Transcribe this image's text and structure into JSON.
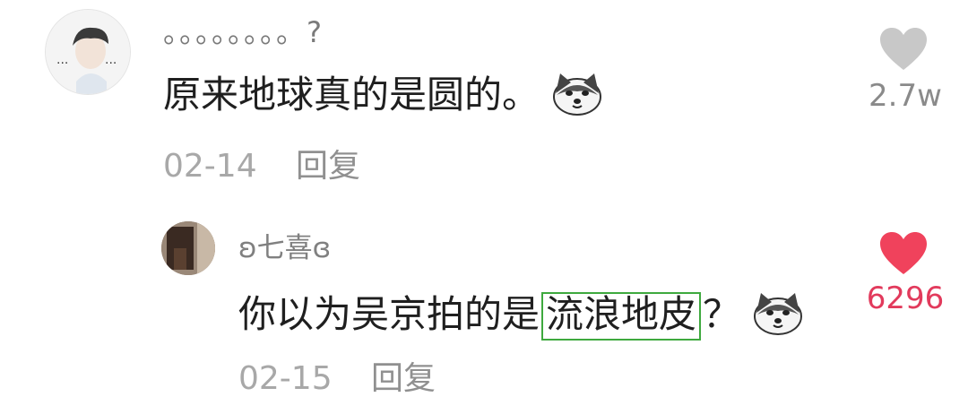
{
  "comments": [
    {
      "username": "。。。。。。。。?",
      "text": "原来地球真的是圆的。",
      "date": "02-14",
      "reply_label": "回复",
      "likes": "2.7w",
      "liked": false,
      "emoji": "husky-sticker"
    },
    {
      "username": "ʚ七喜ɞ",
      "text_before": "你以为吴京拍的是",
      "text_highlight": "流浪地皮",
      "text_after": "？",
      "date": "02-15",
      "reply_label": "回复",
      "likes": "6296",
      "liked": true,
      "emoji": "husky-sticker"
    }
  ],
  "colors": {
    "like_active": "#f0425c",
    "like_inactive": "#c8c8c8",
    "highlight_border": "#3ea93e"
  },
  "icons": {
    "like": "heart-icon",
    "sticker": "husky-emoji"
  }
}
